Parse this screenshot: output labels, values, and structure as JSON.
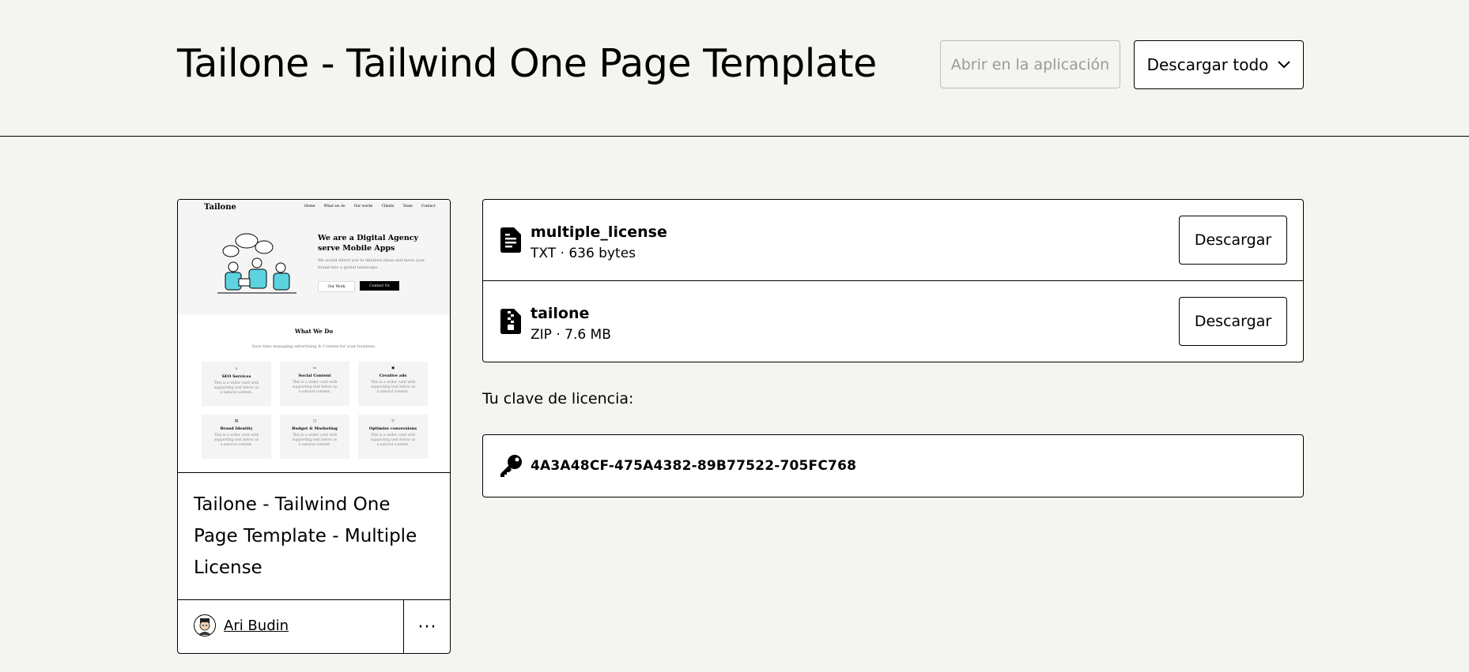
{
  "header": {
    "title": "Tailone - Tailwind One Page Template",
    "open_in_app_label": "Abrir en la aplicación",
    "download_all_label": "Descargar todo"
  },
  "product_card": {
    "title": "Tailone - Tailwind One Page Template - Multiple License",
    "author": "Ari Budin",
    "more_label": "···",
    "thumbnail": {
      "logo": "Tailone",
      "nav": [
        "Home",
        "What we do",
        "Our works",
        "Clients",
        "Team",
        "Contact"
      ],
      "hero_title": "We are a Digital Agency serve Mobile Apps",
      "hero_text": "We would direct you to limitless ideas and move your brand into a global landscape.",
      "hero_btn_1": "Our Work",
      "hero_btn_2": "Contact Us",
      "section_title": "What We Do",
      "section_subtitle": "Save time managing advertising & Content for your business.",
      "services": [
        {
          "name": "SEO Services",
          "text": "This is a wider card with supporting text below as a natural content."
        },
        {
          "name": "Social Content",
          "text": "This is a wider card with supporting text below as a natural content."
        },
        {
          "name": "Creative ads",
          "text": "This is a wider card with supporting text below as a natural content."
        },
        {
          "name": "Brand Identity",
          "text": "This is a wider card with supporting text below as a natural content."
        },
        {
          "name": "Budget & Marketing",
          "text": "This is a wider card with supporting text below as a natural content."
        },
        {
          "name": "Optimize conversions",
          "text": "This is a wider card with supporting text below as a natural content."
        }
      ]
    }
  },
  "files": [
    {
      "name": "multiple_license",
      "meta": "TXT · 636 bytes",
      "icon": "text-file-icon",
      "button": "Descargar"
    },
    {
      "name": "tailone",
      "meta": "ZIP · 7.6 MB",
      "icon": "zip-file-icon",
      "button": "Descargar"
    }
  ],
  "license": {
    "label": "Tu clave de licencia:",
    "key": "4A3A48CF-475A4382-89B77522-705FC768",
    "icon": "key-icon"
  }
}
